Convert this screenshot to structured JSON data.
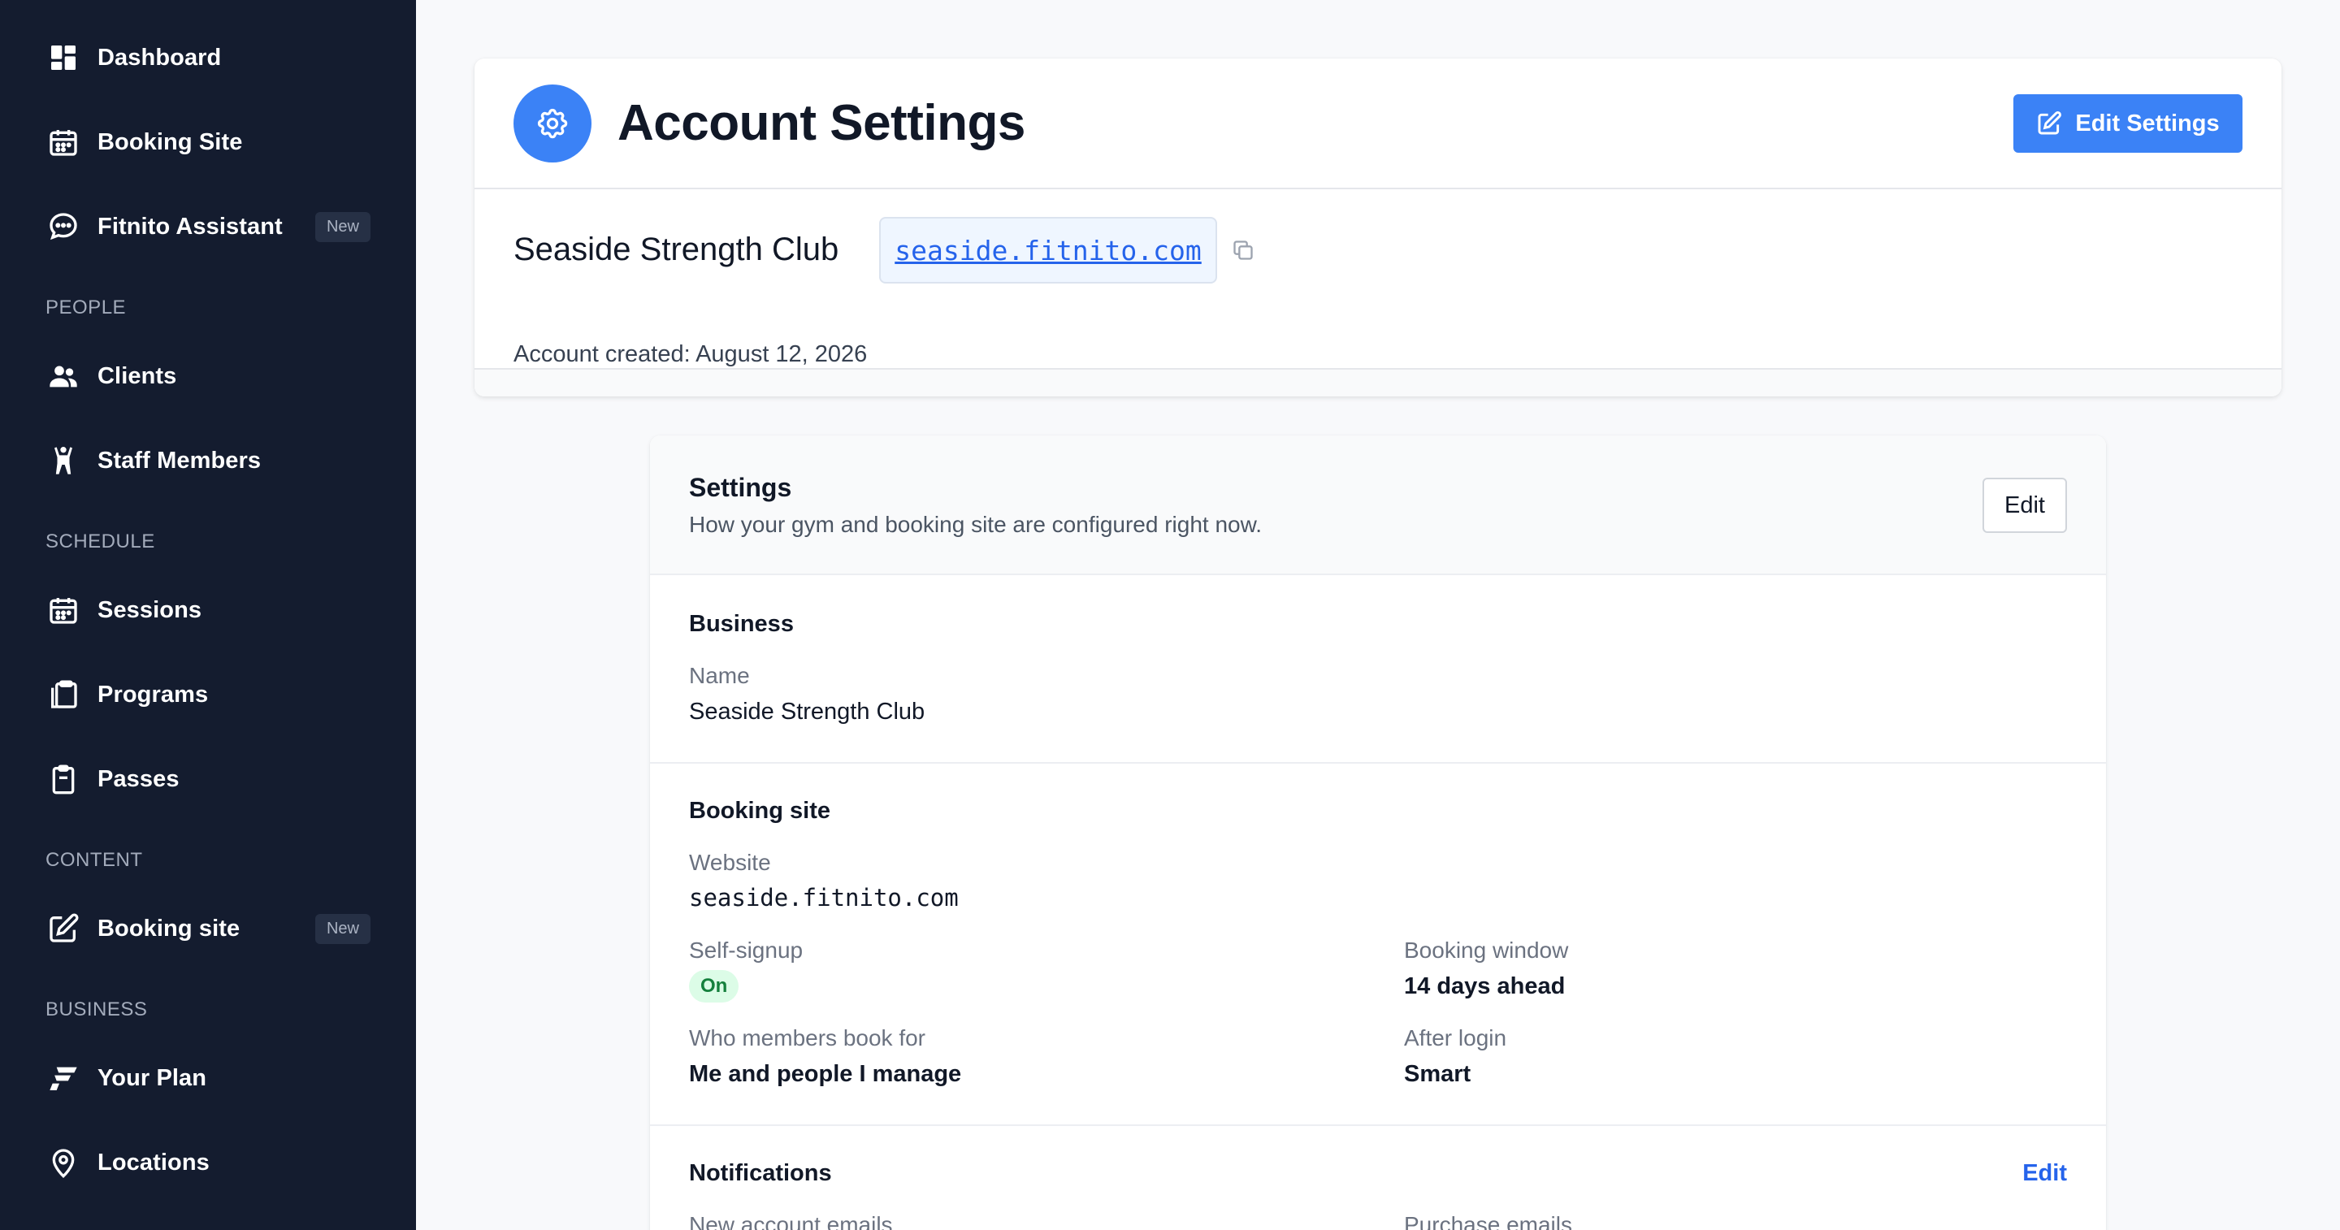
{
  "sidebar": {
    "items": [
      {
        "label": "Dashboard",
        "icon": "dashboard-icon"
      },
      {
        "label": "Booking Site",
        "icon": "calendar-icon"
      },
      {
        "label": "Fitnito Assistant",
        "icon": "chat-icon",
        "badge": "New"
      },
      {
        "label": "Clients",
        "icon": "users-icon"
      },
      {
        "label": "Staff Members",
        "icon": "person-icon"
      },
      {
        "label": "Sessions",
        "icon": "calendar-icon"
      },
      {
        "label": "Programs",
        "icon": "clipboard-stack-icon"
      },
      {
        "label": "Passes",
        "icon": "clipboard-icon"
      },
      {
        "label": "Booking site",
        "icon": "edit-icon",
        "badge": "New"
      },
      {
        "label": "Your Plan",
        "icon": "fitnito-logo-icon"
      },
      {
        "label": "Locations",
        "icon": "map-pin-icon"
      }
    ],
    "sections": {
      "people": "PEOPLE",
      "schedule": "SCHEDULE",
      "content": "CONTENT",
      "business": "BUSINESS"
    }
  },
  "header": {
    "title": "Account Settings",
    "edit_button": "Edit Settings",
    "club_name": "Seaside Strength Club",
    "domain": "seaside.fitnito.com",
    "created": "Account created: August 12, 2026"
  },
  "settings": {
    "title": "Settings",
    "subtitle": "How your gym and booking site are configured right now.",
    "edit_button": "Edit",
    "business": {
      "title": "Business",
      "name_label": "Name",
      "name_value": "Seaside Strength Club"
    },
    "booking_site": {
      "title": "Booking site",
      "website_label": "Website",
      "website_value": "seaside.fitnito.com",
      "self_signup_label": "Self-signup",
      "self_signup_value": "On",
      "booking_window_label": "Booking window",
      "booking_window_value": "14 days ahead",
      "who_book_label": "Who members book for",
      "who_book_value": "Me and people I manage",
      "after_login_label": "After login",
      "after_login_value": "Smart"
    },
    "notifications": {
      "title": "Notifications",
      "edit_link": "Edit",
      "new_account_label": "New account emails",
      "purchase_label": "Purchase emails"
    }
  },
  "colors": {
    "sidebar_bg": "#141c2f",
    "accent": "#3b82f6",
    "link": "#2563eb",
    "status_on_bg": "#dcfce7",
    "status_on_text": "#15803d"
  }
}
